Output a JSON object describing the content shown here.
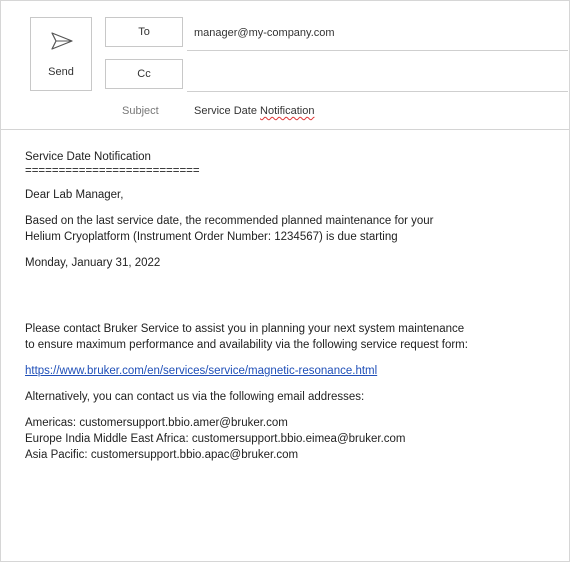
{
  "header": {
    "send_label": "Send",
    "to_label": "To",
    "cc_label": "Cc",
    "to_value": "manager@my-company.com",
    "subject_label": "Subject",
    "subject_prefix": "Service Date ",
    "subject_misspelled": "Notification"
  },
  "body": {
    "title": "Service Date Notification",
    "divider": "==========================",
    "greeting": "Dear Lab Manager,",
    "para1_line1": "Based on the last service date, the recommended planned maintenance for your",
    "para1_line2": "Helium Cryoplatform (Instrument Order Number: 1234567) is due starting",
    "date": "Monday, January 31, 2022",
    "para2_line1": "Please contact Bruker Service to assist you in planning your next system maintenance",
    "para2_line2": "to ensure maximum performance and availability via the following service request form:",
    "link": "https://www.bruker.com/en/services/service/magnetic-resonance.html",
    "alt_text": "Alternatively, you can contact us via the following email addresses:",
    "contacts": [
      "Americas: customersupport.bbio.amer@bruker.com",
      "Europe India Middle East Africa: customersupport.bbio.eimea@bruker.com",
      "Asia Pacific: customersupport.bbio.apac@bruker.com"
    ]
  }
}
